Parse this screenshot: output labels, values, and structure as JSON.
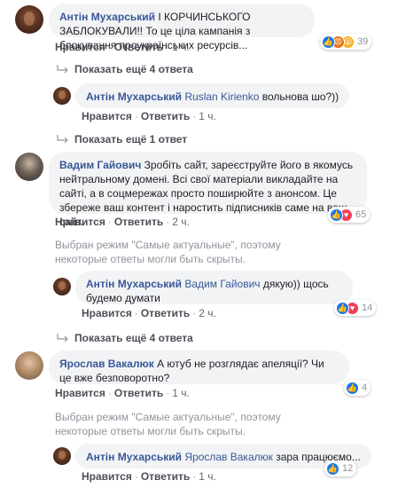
{
  "comments": [
    {
      "author": "Антін Мухарський",
      "text": "І КОРЧИНСЬКОГО ЗАБЛОКУВАЛИ!! То це ціла кампанія з блокування проукраїнських ресурсів...",
      "time": "1 ч.",
      "reactions": [
        "like",
        "angry",
        "wow"
      ],
      "reaction_count": "39"
    },
    {
      "author": "Антін Мухарський",
      "mention": "Ruslan Kirienko",
      "text": "вольнова шо?))",
      "time": "1 ч."
    },
    {
      "author": "Вадим Гайович",
      "text": "Зробіть сайт, зареєструйте його в якомусь нейтральному домені. Всі свої матеріали викладайте на сайті, а в соцмережах просто поширюйте з анонсом. Це збереже ваш контент і наростить підписників саме на ваш сайт.",
      "time": "2 ч.",
      "reactions": [
        "like",
        "love"
      ],
      "reaction_count": "65"
    },
    {
      "author": "Антін Мухарський",
      "mention": "Вадим Гайович",
      "text": "дякую)) щось будемо думати",
      "time": "2 ч.",
      "reactions": [
        "like",
        "love"
      ],
      "reaction_count": "14"
    },
    {
      "author": "Ярослав Вакалюк",
      "text": "А ютуб не розглядає апеляції? Чи це вже безповоротно?",
      "time": "1 ч.",
      "reactions": [
        "like"
      ],
      "reaction_count": "4"
    },
    {
      "author": "Антін Мухарський",
      "mention": "Ярослав Вакалюк",
      "text": "зара працюємо...",
      "time": "1 ч.",
      "reactions": [
        "like"
      ],
      "reaction_count": "12"
    }
  ],
  "actions": {
    "like": "Нравится",
    "reply": "Ответить",
    "sep": "·"
  },
  "more_replies": {
    "four": "Показать ещё 4 ответа",
    "one": "Показать ещё 1 ответ"
  },
  "filter_note": "Выбран режим \"Самые актуальные\", поэтому некоторые ответы могли быть скрыты.",
  "colors": {
    "link": "#385898",
    "bubble": "#f2f3f5",
    "like": "#1877f2",
    "love": "#f33e58",
    "muted": "#90949c"
  }
}
